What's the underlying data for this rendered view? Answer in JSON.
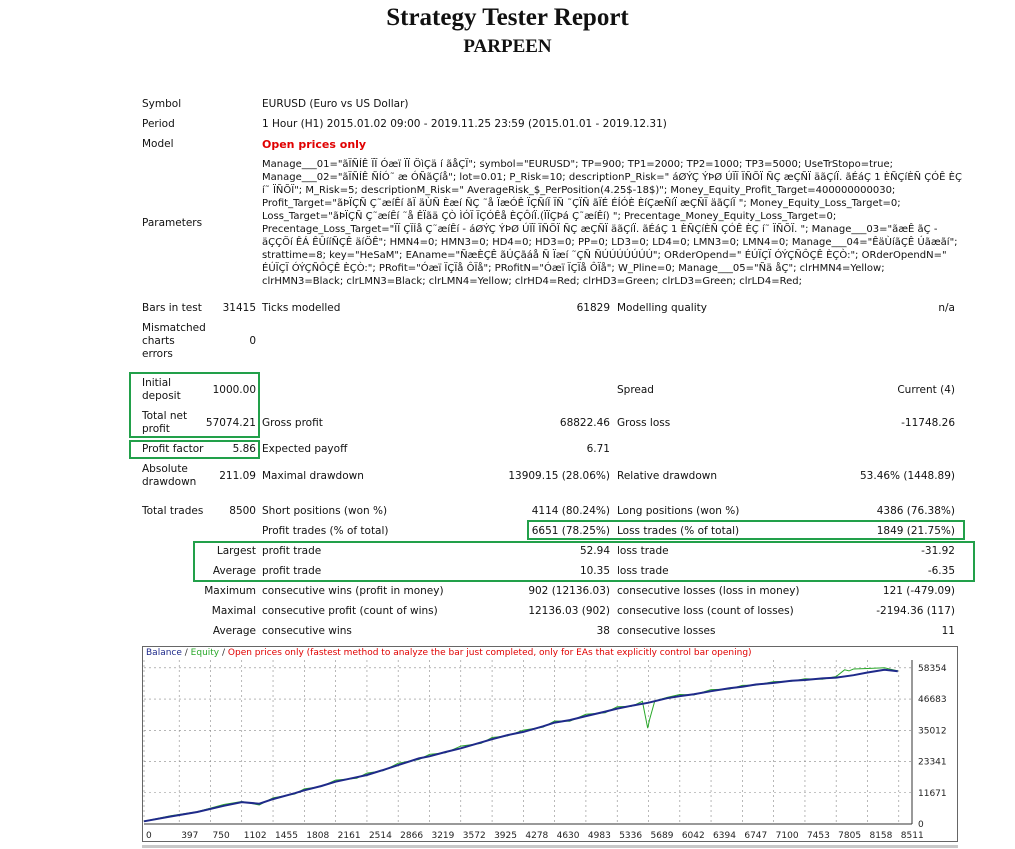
{
  "report": {
    "title": "Strategy Tester Report",
    "subtitle": "PARPEEN"
  },
  "info": {
    "symbol_label": "Symbol",
    "symbol_value": "EURUSD (Euro vs US Dollar)",
    "period_label": "Period",
    "period_value": "1 Hour (H1) 2015.01.02 09:00 - 2019.11.25 23:59 (2015.01.01 - 2019.12.31)",
    "model_label": "Model",
    "model_value": "Open prices only",
    "parameters_label": "Parameters",
    "parameters_value": "Manage___01=\"ãÏÑÍÊ ÏÏ Óæï ÏÏ ÖìÇä í ãåÇÏ\"; symbol=\"EURUSD\"; TP=900; TP1=2000; TP2=1000; TP3=5000; UseTrStopo=true; Manage___02=\"ãÏÑÍÊ ÑÍÓ˜ æ ÓÑãÇíå\"; lot=0.01; P_Risk=10; descriptionP_Risk=\" áØÝÇ ÝÞØ ÚÏÏ ÏÑÕÏ ÑÇ æÇÑÏ äãÇíÏ. ãÉáÇ 1 ÈÑÇíÈÑ ÇÓÊ ÈÇ í˜ ÏÑÕÏ\"; M_Risk=5; descriptionM_Risk=\" AverageRisk_$_PerPosition(4.25$-18$)\"; Money_Equity_Profit_Target=400000000030; Profit_Target=\"ãÞÏÇÑ Ç˜æíÊí ãÏ äÙÑ Èæí ÑÇ ˜å ÏæÓÊ ÏÇÑíÏ ÏÑ ˜ÇÏÑ ãÏÉ ÉÍÓÈ ÈíÇæÑíÏ æÇÑÏ äãÇíÏ \"; Money_Equity_Loss_Target=0; Loss_Target=\"ãÞÏÇÑ Ç˜æíÊí ˜å ÊÏãä ÇÒ ÌÓÏ ÏÇÓÊå ÈÇÔíÏ.(ÏÏÇÞá Ç˜æíÊí) \"; Precentage_Money_Equity_Loss_Target=0; Precentage_Loss_Target=\"ÏÏ ÇÏÍå Ç˜æíÊí - áØÝÇ ÝÞØ ÚÏÏ ÏÑÕÏ ÑÇ æÇÑÏ äãÇíÏ. ãÉáÇ 1 ÈÑÇíÈÑ ÇÓÊ ÈÇ í˜ ÏÑÕÏ. \"; Manage___03=\"ãæÊ ãÇ - äÇÇÖí ÊÁ ÊÛííÑÇÊ äíÖÊ\"; HMN4=0; HMN3=0; HD4=0; HD3=0; PP=0; LD3=0; LD4=0; LMN3=0; LMN4=0; Manage___04=\"ÊäÙíãÇÊ Úãæãí\"; strattime=8; key=\"HeSaM\"; EAname=\"ÑæÈÇÊ ãÚÇãáå Ñ Ïæí ˜ÇÑ ÑÚÚÚÚÚÚÚ\"; ORderOpend=\" ÉÚÏÇÏ ÓÝÇÑÔÇÊ ÈÇÒ:\"; ORderOpendN=\" ÉÚÏÇÏ ÓÝÇÑÔÇÊ ÈÇÒ:\"; PRofit=\"Óæï ÏÇÏå ÔÏå\"; PRofitN=\"Óæï ÏÇÏå ÔÏå\"; W_Pline=0; Manage___05=\"Ñä åÇ\"; clrHMN4=Yellow; clrHMN3=Black; clrLMN3=Black; clrLMN4=Yellow; clrHD4=Red; clrHD3=Green; clrLD3=Green; clrLD4=Red;"
  },
  "stats": {
    "bars_label": "Bars in test",
    "bars_value": "31415",
    "ticks_label": "Ticks modelled",
    "ticks_value": "61829",
    "quality_label": "Modelling quality",
    "quality_value": "n/a",
    "mismatched_label_1": "Mismatched",
    "mismatched_label_2": "charts",
    "mismatched_label_3": "errors",
    "mismatched_value": "0",
    "initial_deposit_label_1": "Initial",
    "initial_deposit_label_2": "deposit",
    "initial_deposit_value": "1000.00",
    "spread_label": "Spread",
    "spread_value": "Current (4)",
    "total_net_label_1": "Total net",
    "total_net_label_2": "profit",
    "total_net_value": "57074.21",
    "gross_profit_label": "Gross profit",
    "gross_profit_value": "68822.46",
    "gross_loss_label": "Gross loss",
    "gross_loss_value": "-11748.26",
    "profit_factor_label": "Profit factor",
    "profit_factor_value": "5.86",
    "expected_payoff_label": "Expected payoff",
    "expected_payoff_value": "6.71",
    "abs_dd_label_1": "Absolute",
    "abs_dd_label_2": "drawdown",
    "abs_dd_value": "211.09",
    "max_dd_label": "Maximal drawdown",
    "max_dd_value": "13909.15 (28.06%)",
    "rel_dd_label": "Relative drawdown",
    "rel_dd_value": "53.46% (1448.89)",
    "total_trades_label": "Total trades",
    "total_trades_value": "8500",
    "short_label": "Short positions (won %)",
    "short_value": "4114 (80.24%)",
    "long_label": "Long positions (won %)",
    "long_value": "4386 (76.38%)",
    "profit_trades_label": "Profit trades (% of total)",
    "profit_trades_value": "6651 (78.25%)",
    "loss_trades_label": "Loss trades (% of total)",
    "loss_trades_value": "1849 (21.75%)",
    "largest_label": "Largest",
    "largest_profit_label": "profit trade",
    "largest_profit_value": "52.94",
    "largest_loss_label": "loss trade",
    "largest_loss_value": "-31.92",
    "average_label": "Average",
    "average_profit_label": "profit trade",
    "average_profit_value": "10.35",
    "average_loss_label": "loss trade",
    "average_loss_value": "-6.35",
    "maximum_label": "Maximum",
    "max_cons_wins_label": "consecutive wins (profit in money)",
    "max_cons_wins_value": "902 (12136.03)",
    "max_cons_losses_label": "consecutive losses (loss in money)",
    "max_cons_losses_value": "121 (-479.09)",
    "maximal_label": "Maximal",
    "max_cons_profit_label": "consecutive profit (count of wins)",
    "max_cons_profit_value": "12136.03 (902)",
    "max_cons_loss_label": "consecutive loss (count of losses)",
    "max_cons_loss_value": "-2194.36 (117)",
    "average2_label": "Average",
    "avg_cons_wins_label": "consecutive wins",
    "avg_cons_wins_value": "38",
    "avg_cons_losses_label": "consecutive losses",
    "avg_cons_losses_value": "11"
  },
  "legend": {
    "balance": "Balance",
    "sep1": " / ",
    "equity": "Equity",
    "sep2": " / ",
    "note": "Open prices only (fastest method to analyze the bar just completed, only for EAs that explicitly control bar opening)"
  },
  "colors": {
    "balance": "#1f2a8a",
    "equity": "#2aa82a",
    "highlight": "#22a04a",
    "model_text": "#e00000"
  },
  "chart_data": {
    "type": "line",
    "x_ticks": [
      "0",
      "397",
      "750",
      "1102",
      "1455",
      "1808",
      "2161",
      "2514",
      "2866",
      "3219",
      "3572",
      "3925",
      "4278",
      "4630",
      "4983",
      "5336",
      "5689",
      "6042",
      "6394",
      "6747",
      "7100",
      "7453",
      "7805",
      "8158",
      "8511"
    ],
    "y_ticks": [
      "58354",
      "46683",
      "35012",
      "23341",
      "11671",
      "0"
    ],
    "xlim": [
      0,
      8500
    ],
    "ylim": [
      0,
      58354
    ],
    "series": [
      {
        "name": "Balance",
        "x": [
          0,
          300,
          600,
          900,
          1102,
          1300,
          1455,
          1700,
          1808,
          2000,
          2161,
          2400,
          2514,
          2700,
          2866,
          3100,
          3219,
          3400,
          3572,
          3800,
          3925,
          4100,
          4278,
          4500,
          4630,
          4800,
          4983,
          5200,
          5336,
          5500,
          5689,
          5900,
          6042,
          6200,
          6394,
          6600,
          6747,
          6900,
          7100,
          7300,
          7453,
          7650,
          7805,
          8000,
          8158,
          8350,
          8500
        ],
        "y": [
          1000,
          2800,
          4500,
          6800,
          8200,
          7600,
          9300,
          11500,
          12600,
          14200,
          15800,
          17500,
          18300,
          20200,
          22000,
          24500,
          25300,
          26900,
          28300,
          30500,
          31700,
          33200,
          34400,
          36500,
          37900,
          38800,
          40300,
          42000,
          43100,
          44200,
          45300,
          47000,
          47800,
          48500,
          49600,
          50700,
          51300,
          52100,
          52700,
          53500,
          53800,
          54400,
          54700,
          55600,
          56600,
          57600,
          57074
        ]
      },
      {
        "name": "Equity",
        "x": [
          0,
          300,
          600,
          900,
          1102,
          1300,
          1455,
          1700,
          1808,
          2000,
          2161,
          2400,
          2514,
          2700,
          2866,
          3100,
          3219,
          3400,
          3572,
          3800,
          3925,
          4100,
          4278,
          4500,
          4630,
          4800,
          4983,
          5200,
          5336,
          5500,
          5620,
          5680,
          5700,
          5760,
          5900,
          6042,
          6200,
          6394,
          6600,
          6747,
          6900,
          7100,
          7300,
          7453,
          7650,
          7805,
          7900,
          7950,
          8000,
          8158,
          8350,
          8500
        ],
        "y": [
          1000,
          3100,
          4600,
          7300,
          8400,
          7100,
          9800,
          11200,
          13100,
          14000,
          16400,
          17100,
          19000,
          19900,
          22700,
          24100,
          26000,
          26600,
          29100,
          30100,
          32300,
          32900,
          35100,
          36200,
          38500,
          38400,
          41000,
          41600,
          43800,
          44000,
          45800,
          35800,
          38900,
          46000,
          47300,
          48400,
          48200,
          50200,
          50400,
          51800,
          51900,
          53200,
          53300,
          54300,
          54100,
          55100,
          57600,
          57200,
          57900,
          58100,
          58354,
          57200
        ]
      }
    ]
  }
}
